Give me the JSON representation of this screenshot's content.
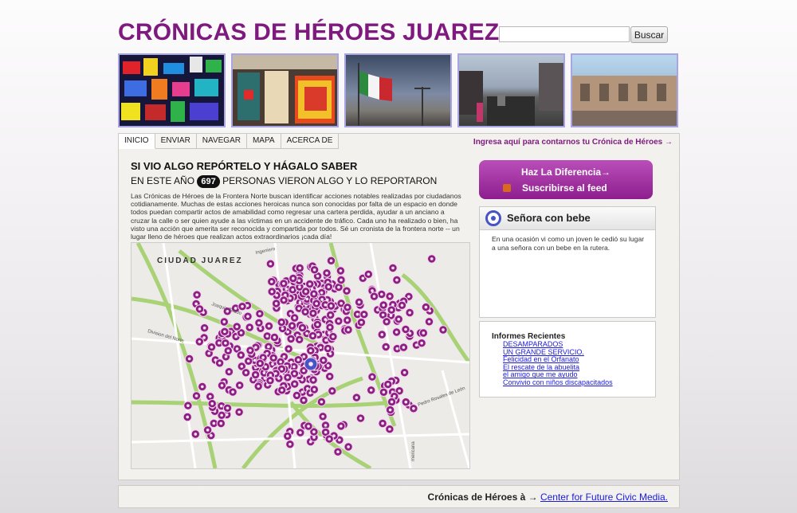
{
  "header": {
    "title": "CRÓNICAS DE HÉROES JUAREZ",
    "search_placeholder": "",
    "search_button": "Buscar"
  },
  "banner": {
    "photos": [
      "collage-photo",
      "storefront-photo",
      "flag-photo",
      "street-photo",
      "building-photo"
    ]
  },
  "nav": {
    "tabs": [
      "INICIO",
      "ENVIAR",
      "NAVEGAR",
      "MAPA",
      "ACERCA DE"
    ],
    "active_tab": "INICIO",
    "login_link": "Ingresa aquí para contarnos tu Crónica de Héroes →"
  },
  "main": {
    "headline": "SI VIO ALGO REPÓRTELO Y HÁGALO SABER",
    "counter_prefix": "EN ESTE AÑO",
    "counter_value": "697",
    "counter_suffix": "PERSONAS VIERON ALGO Y LO REPORTARON",
    "intro": "Las Crónicas de Héroes de la Frontera Norte buscan identificar acciones notables realizadas por ciudadanos cotidianamente. Muchas de estas acciones heroicas nunca son conocidas por falta de un espacio en donde todos puedan compartir actos de amabilidad como regresar una cartera perdida, ayudar a un anciano a cruzar la calle o ser quien ayude a las víctimas en un accidente de tráfico. Cada uno ha realizado o bien, ha visto una acción que amerita ser reconocida y compartida por todos. Sé un cronista de la frontera norte -- un lugar lleno de héroes que realizan actos extraordinarios ¡cada día!"
  },
  "map": {
    "city_label": "CIUDAD JUAREZ",
    "street_labels": [
      "Ingeniero",
      "Joaquin Tirado",
      "Division del Norte",
      "Pedro Rosales de León",
      "Paseo Triunfo",
      "mericana"
    ],
    "marker_color": "#8d1f83",
    "selected_marker_color": "#4654c8"
  },
  "sidebar": {
    "cta_primary": "Haz La Diferencia→",
    "cta_secondary": "Suscribirse al feed",
    "featured_title": "Señora con bebe",
    "featured_body": "En una ocasión vi como un joven le cedió su lugar a una señora con un bebe en la rutera.",
    "reports_title": "Informes Recientes",
    "reports": [
      "DESAMPARADOS",
      "UN GRANDE SERVICIO.",
      "Felicidad en el Orfanato",
      "El rescate de la abuelita",
      "el amigo que me ayudo",
      "Convivio con niños discapacitados"
    ]
  },
  "footer": {
    "text": "Crónicas de Héroes à →",
    "link": "Center for Future Civic Media."
  },
  "colors": {
    "brand": "#7e1a7e",
    "link": "#1a1ae0",
    "cta_gradient_top": "#b94fb9",
    "cta_gradient_bottom": "#8e1e8e"
  }
}
